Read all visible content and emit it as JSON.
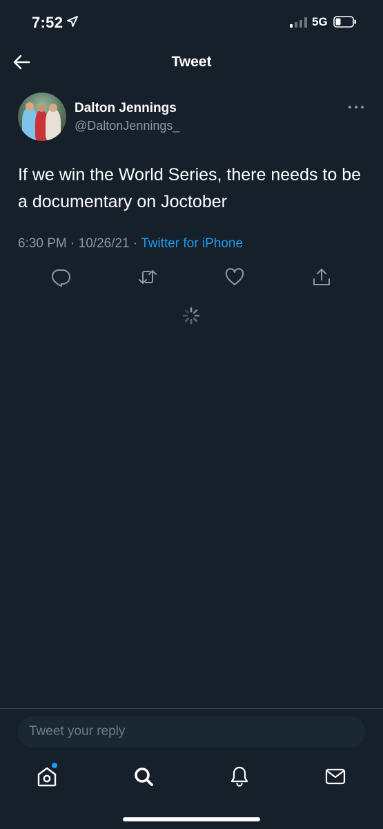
{
  "status_bar": {
    "time": "7:52",
    "network": "5G"
  },
  "header": {
    "title": "Tweet"
  },
  "tweet": {
    "author_name": "Dalton Jennings",
    "author_handle": "@DaltonJennings_",
    "text": "If we win the World Series, there needs to be a documentary on Joctober",
    "time": "6:30 PM",
    "date": "10/26/21",
    "separator": "·",
    "source": "Twitter for iPhone"
  },
  "actions": [
    "reply-icon",
    "retweet-icon",
    "like-icon",
    "share-icon"
  ],
  "reply": {
    "placeholder": "Tweet your reply"
  },
  "tab_bar": [
    "home-icon",
    "search-icon",
    "notifications-icon",
    "messages-icon"
  ],
  "colors": {
    "background": "#15202b",
    "accent": "#1d9bf0",
    "secondary_text": "#8b98a5",
    "input_bg": "#1b2733"
  }
}
